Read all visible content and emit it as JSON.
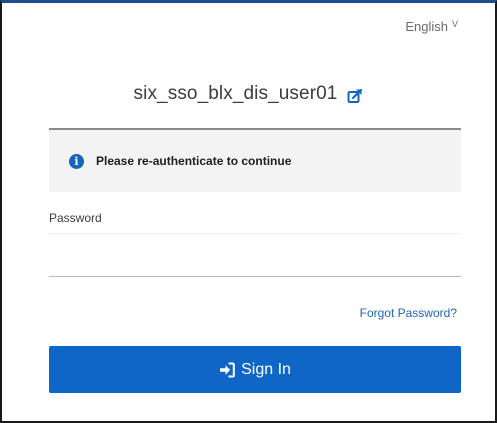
{
  "language": {
    "label": "English",
    "chevron": "V"
  },
  "user": {
    "username": "six_sso_blx_dis_user01"
  },
  "banner": {
    "icon": "info-icon",
    "message": "Please re-authenticate to continue"
  },
  "password": {
    "label": "Password",
    "value": "",
    "placeholder": ""
  },
  "forgot_password": {
    "label": "Forgot Password?"
  },
  "sign_in": {
    "label": "Sign In",
    "icon": "sign-in-icon"
  },
  "colors": {
    "primary": "#0f66c6",
    "link": "#1f66b8",
    "info": "#1565c0",
    "banner_bg": "#f3f3f3",
    "top_border": "#1f4e8f"
  }
}
